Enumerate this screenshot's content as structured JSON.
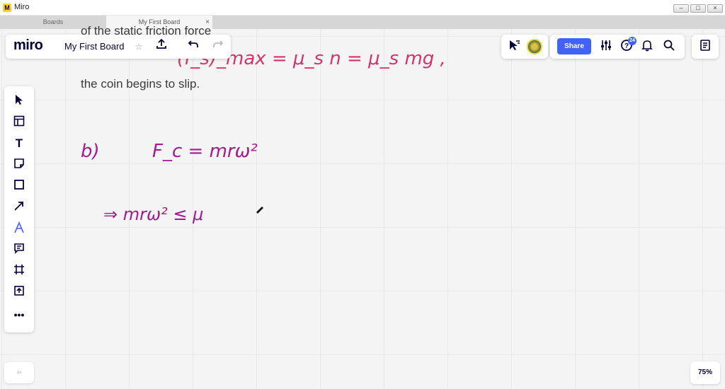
{
  "window": {
    "app_title": "Miro",
    "minimize": "–",
    "maximize": "□",
    "close": "×"
  },
  "tabs": [
    {
      "label": "Boards"
    },
    {
      "label": "My First Board",
      "close": "×"
    }
  ],
  "board": {
    "logo": "miro",
    "name": "My First Board"
  },
  "share": {
    "label": "Share"
  },
  "notifications": {
    "help_badge": "24"
  },
  "zoom": {
    "level": "75%"
  },
  "expand": {
    "label": "››"
  },
  "canvas": {
    "line1": "of the static friction force",
    "line2": "the coin begins to slip.",
    "hw_line1": "(f_s)_max = μ_s n = μ_s mg ,",
    "hw_b_label": "b)",
    "hw_fc": "F_c = mrω²",
    "hw_arrow": "⇒  mrω²  ≤  μ"
  },
  "colors": {
    "accent": "#4262ff",
    "ink_purple": "#a21c8f",
    "ink_red": "#d6336c",
    "text": "#050038"
  }
}
